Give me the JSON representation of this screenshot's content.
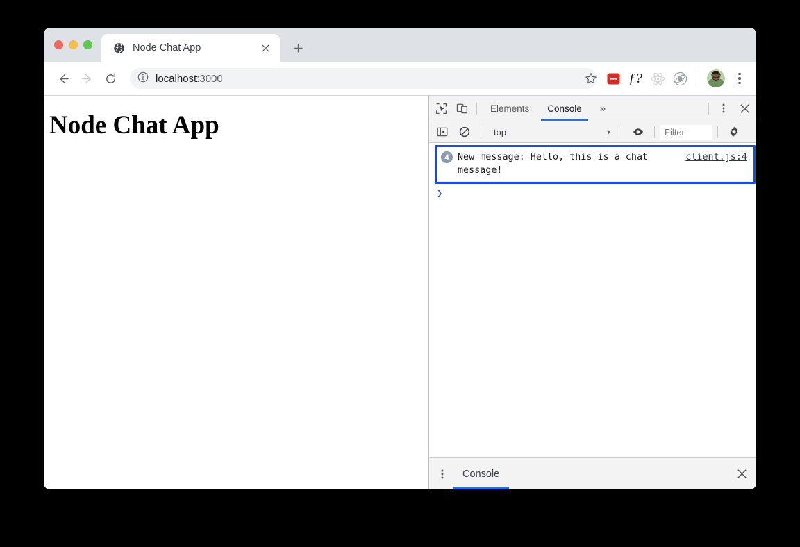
{
  "window": {
    "traffic_lights": [
      "close",
      "minimize",
      "zoom"
    ],
    "colors": {
      "close": "#ed6a5e",
      "minimize": "#f5bd4f",
      "zoom": "#61c554",
      "accent_blue": "#1a73e8",
      "highlight_blue": "#1a4ae0",
      "tabstrip_bg": "#dee1e6",
      "devtools_bg": "#f3f3f3"
    }
  },
  "tab": {
    "favicon": "globe-icon",
    "title": "Node Chat App",
    "close_label": "×",
    "newtab_label": "+"
  },
  "toolbar": {
    "back": "back-arrow-icon",
    "forward": "forward-arrow-icon",
    "reload": "reload-icon",
    "site_info": "info-circle-icon",
    "url_host": "localhost",
    "url_port": ":3000",
    "url_full": "localhost:3000",
    "star": "star-icon",
    "extensions": [
      {
        "name": "lastpass-extension-icon",
        "label": "•••"
      },
      {
        "name": "f-question-extension-icon",
        "label": "ƒ?"
      },
      {
        "name": "react-devtools-extension-icon",
        "label": ""
      },
      {
        "name": "ionic-extension-icon",
        "label": ""
      }
    ],
    "avatar": "user-avatar",
    "menu": "chrome-menu-kebab-icon"
  },
  "page": {
    "heading": "Node Chat App"
  },
  "devtools": {
    "inspect_icon": "inspect-element-icon",
    "device_icon": "device-toolbar-icon",
    "tabs": [
      {
        "label": "Elements",
        "active": false
      },
      {
        "label": "Console",
        "active": true
      }
    ],
    "overflow_label": "»",
    "more_icon": "devtools-kebab-icon",
    "close_label": "✕",
    "filterbar": {
      "sidebar_icon": "console-sidebar-icon",
      "clear_icon": "clear-console-icon",
      "context": "top",
      "context_caret": "▼",
      "eye_icon": "live-expression-eye-icon",
      "filter_placeholder": "Filter",
      "settings_icon": "settings-gear-icon"
    },
    "console": {
      "entries": [
        {
          "repeat_count": "4",
          "message": "New message: Hello, this is a chat message!",
          "source": "client.js:4",
          "highlighted": true
        }
      ],
      "prompt": "❯"
    },
    "drawer": {
      "more_icon": "drawer-kebab-icon",
      "tab_label": "Console",
      "close_label": "✕"
    }
  }
}
